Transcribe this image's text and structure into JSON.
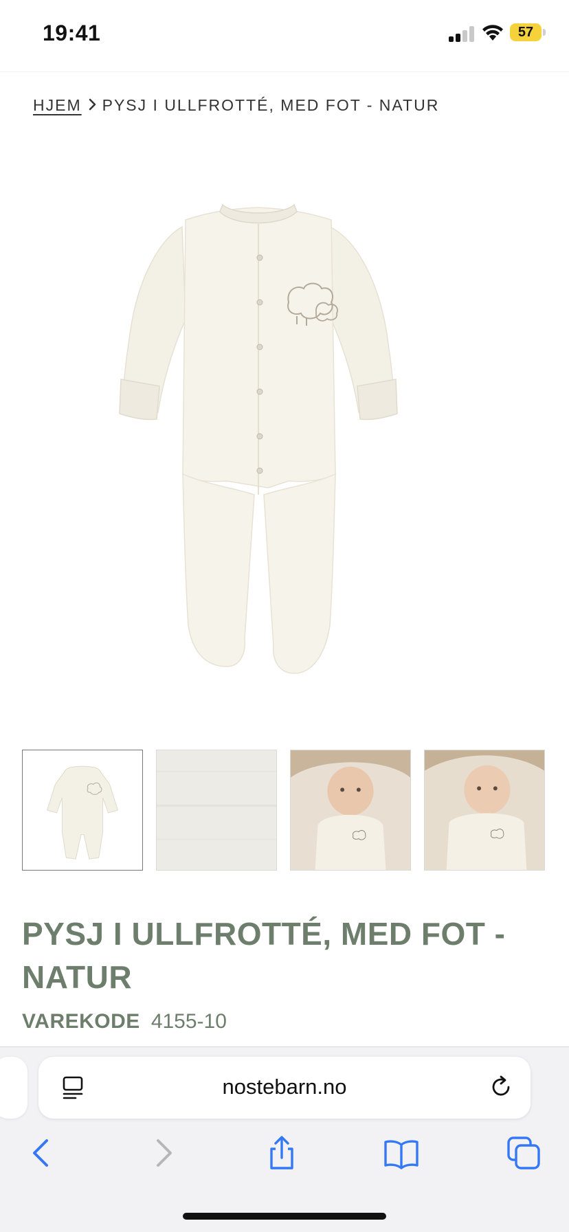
{
  "status_bar": {
    "time": "19:41",
    "battery": "57",
    "battery_color": "#f6d23a",
    "signal_icon": "cellular-signal-icon",
    "wifi_icon": "wifi-icon"
  },
  "breadcrumb": {
    "home": "HJEM",
    "separator_icon": "chevron-right-icon",
    "current": "PYSJ I ULLFROTTÉ, MED FOT - NATUR"
  },
  "product": {
    "title": "PYSJ I ULLFROTTÉ, MED FOT - NATUR",
    "sku_label": "VAREKODE",
    "sku_value": "4155-10",
    "title_color": "#6d7e6c"
  },
  "gallery": {
    "main_image": "wool-terry-footed-sleepsuit-natural",
    "thumbnails": [
      {
        "name": "sleepsuit-front",
        "active": true
      },
      {
        "name": "fabric-closeup",
        "active": false
      },
      {
        "name": "baby-wearing-sleepsuit-1",
        "active": false
      },
      {
        "name": "baby-wearing-sleepsuit-2",
        "active": false
      }
    ]
  },
  "browser": {
    "url": "nostebarn.no",
    "reader_icon": "page-menu-icon",
    "reload_icon": "reload-icon",
    "accent_color": "#3478f6"
  },
  "toolbar": {
    "items": [
      "back-icon",
      "forward-icon",
      "share-icon",
      "bookmarks-icon",
      "tabs-icon"
    ]
  }
}
